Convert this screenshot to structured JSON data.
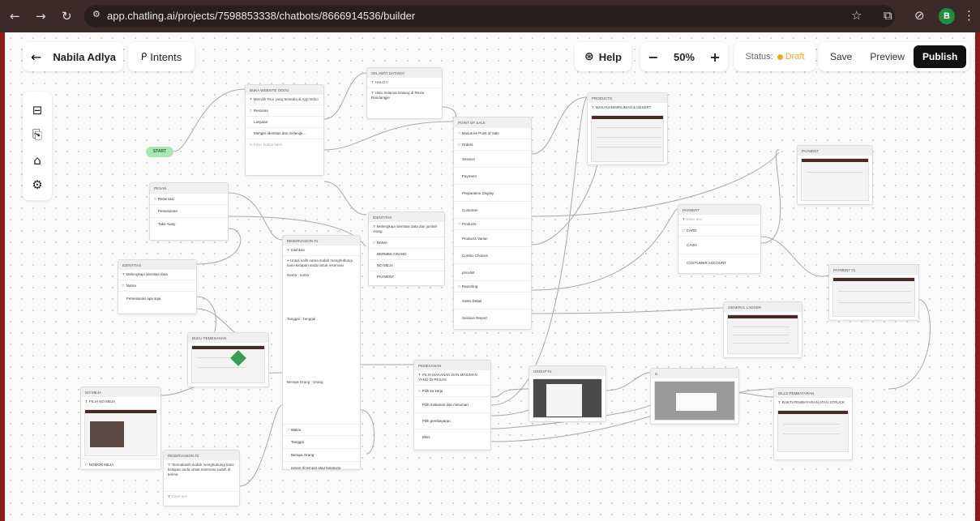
{
  "browser": {
    "url": "app.chatling.ai/projects/7598853338/chatbots/8666914536/builder",
    "nav_icons": [
      "back-arrow-icon",
      "forward-arrow-icon",
      "reload-icon"
    ],
    "profile_initial": "B"
  },
  "toolbar": {
    "bot_name": "Nabila Adlya",
    "intents_label": "Intents",
    "help_label": "Help",
    "zoom_level": "50%",
    "status_label": "Status:",
    "status_value": "Draft",
    "save_label": "Save",
    "preview_label": "Preview",
    "publish_label": "Publish",
    "colors": {
      "draft": "#f5a623",
      "publish_bg": "#111111"
    }
  },
  "sidebar": [
    "layout-icon",
    "document-icon",
    "bot-icon",
    "settings-icon"
  ],
  "canvas": {
    "start_label": "START",
    "nodes": {
      "odoo": {
        "title": "Buka Website Odoo",
        "text": "Memilih Fitur yang tersedia di App Odoo",
        "section": "Restoran",
        "rows": [
          "Lanjutan",
          "Mengisi identitas dan melengk..."
        ],
        "placeholder": "Enter button label"
      },
      "selamat": {
        "title": "SELAMAT DATANG!",
        "text1": "HALO !!",
        "text2": "Halo Selamat Datang di Resto Randangjie"
      },
      "pos": {
        "title": "POINT OF SALE",
        "section1": "Masuk ke Point of Sale",
        "section2": "Orders",
        "rows2": [
          "Session",
          "Payment",
          "Preparation Display",
          "Customer"
        ],
        "section3": "Products",
        "rows3": [
          "Products Varian",
          "Combo Choices",
          "pricelist"
        ],
        "section4": "Reporting",
        "rows4": [
          "Sales Detail",
          "Session Report"
        ]
      },
      "products": {
        "title": "PRODUCTS",
        "text": "MAKANAN/MINUMAN & DESERT"
      },
      "payment_shot": {
        "title": "PAYMENT"
      },
      "payment": {
        "title": "PAYMENT",
        "placeholder": "Enter text",
        "section": "CARD",
        "rows": [
          "CASH",
          "COSTUMER ACCOUNT"
        ]
      },
      "payment2": {
        "title": "PAYMENT #1"
      },
      "general": {
        "title": "GENERAL LADGER"
      },
      "pesan": {
        "title": "PESAN",
        "section": "Reservasi",
        "rows": [
          "Pemesanan",
          "Take Away"
        ]
      },
      "identitas1": {
        "title": "IDENTITAS",
        "text": "Melengkapi identitas data dan jumlah orang",
        "section": "NAMA",
        "rows": [
          "BERMEK GRAND",
          "NO MEJA",
          "PAYMENT"
        ]
      },
      "reservasi": {
        "title": "RESERVASION #1",
        "text1": "Silahkan",
        "text2": "Untuk kalih nama sudah menghubungi kami ketapan anda untuk reservasi",
        "text3": "Nama : nama",
        "text4": "Tanggal : Tanggal",
        "text5": "Berapa Orang : Orang",
        "section": "Waktu",
        "rows": [
          "Tanggal",
          "Berapa Orang",
          "pesan di tempat atau langsung"
        ]
      },
      "identitas2": {
        "title": "IDENTITAS",
        "text": "Melengkapi identitas data",
        "section": "Nama",
        "rows": [
          "Pemesanan apa saja"
        ]
      },
      "buku": {
        "title": "BUKU PEMESANAN"
      },
      "nomeja": {
        "title": "NO MEJA",
        "text": "PILIH NO MEJA",
        "section": "NOMOR MEJA"
      },
      "reservasi2": {
        "title": "RESERVASION #2",
        "text": "Terimakasih sudah menghubungi kami ketapan anda untuk reservasi sudah di terima",
        "placeholder": "Enter text"
      },
      "pemesanan": {
        "title": "PEMESANAN",
        "text": "PILIH MAKANAN DAN MINUMAN YANG DI PESAN",
        "section": "Pilih ke kerja",
        "rows": [
          "Pilih makanan dan minuman",
          "Pilih pembayaran",
          "Bliss"
        ]
      },
      "group": {
        "title": "Group #1"
      },
      "d": {
        "title": "D"
      },
      "bukti": {
        "title": "Bills Pembayaran",
        "text": "BUKTI PEMBAYARAN ATAU STRUCK"
      }
    }
  }
}
